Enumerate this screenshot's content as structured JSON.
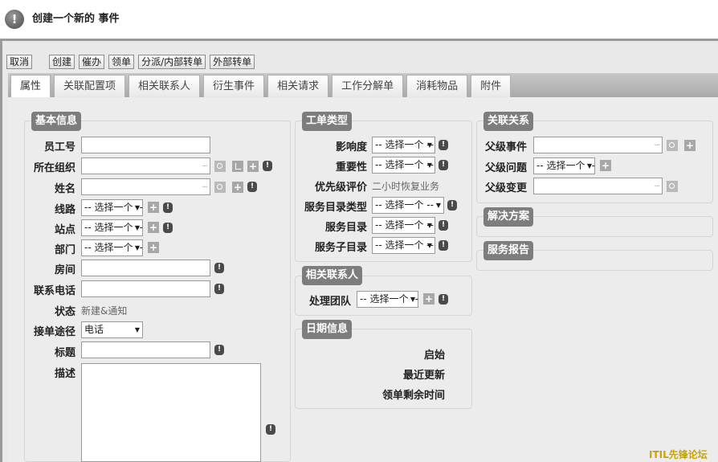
{
  "window": {
    "title": "创建一个新的 事件"
  },
  "toolbar": {
    "cancel": "取消",
    "create": "创建",
    "remind": "催办",
    "claim": "领单",
    "dispatch": "分派/内部转单",
    "external": "外部转单"
  },
  "tabs": [
    "属性",
    "关联配置项",
    "相关联系人",
    "衍生事件",
    "相关请求",
    "工作分解单",
    "消耗物品",
    "附件"
  ],
  "basic": {
    "legend": "基本信息",
    "employee_id": "员工号",
    "org": "所在组织",
    "name": "姓名",
    "line": "线路",
    "line_value": "-- 选择一个 --",
    "site": "站点",
    "site_value": "-- 选择一个 --",
    "dept": "部门",
    "dept_value": "-- 选择一个 --",
    "room": "房间",
    "phone": "联系电话",
    "status": "状态",
    "status_value": "新建&通知",
    "channel": "接单途径",
    "channel_value": "电话",
    "subject": "标题",
    "description": "描述"
  },
  "ticket_type": {
    "legend": "工单类型",
    "impact": "影响度",
    "impact_value": "-- 选择一个 --",
    "urgency": "重要性",
    "urgency_value": "-- 选择一个 --",
    "priority": "优先级评价",
    "priority_value": "二小时恢复业务",
    "catalog_type": "服务目录类型",
    "catalog_type_value": "-- 选择一个 --",
    "catalog": "服务目录",
    "catalog_value": "-- 选择一个 --",
    "sub_catalog": "服务子目录",
    "sub_catalog_value": "-- 选择一个 --"
  },
  "contacts": {
    "legend": "相关联系人",
    "team": "处理团队",
    "team_value": "-- 选择一个 --"
  },
  "dates": {
    "legend": "日期信息",
    "start": "启始",
    "updated": "最近更新",
    "remaining": "领单剩余时间"
  },
  "relations": {
    "legend": "关联关系",
    "parent_incident": "父级事件",
    "parent_problem": "父级问题",
    "parent_problem_value": "-- 选择一个 --",
    "parent_change": "父级变更"
  },
  "solution": {
    "legend": "解决方案"
  },
  "report": {
    "legend": "服务报告"
  },
  "watermark": "ITIL先锋论坛",
  "icons": [
    "info-icon",
    "search-icon",
    "tree-icon",
    "plus-icon"
  ]
}
